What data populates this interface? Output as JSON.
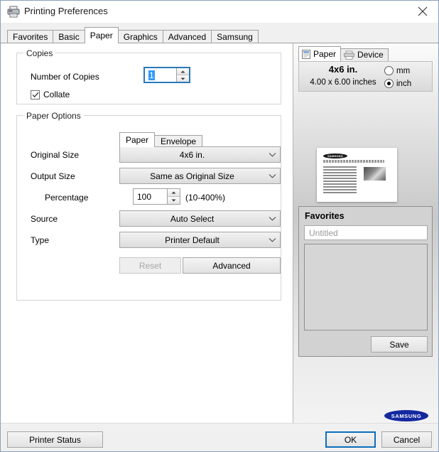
{
  "window": {
    "title": "Printing Preferences",
    "icon": "printer-icon",
    "close_label": "✕"
  },
  "tabs": [
    {
      "label": "Favorites",
      "active": false
    },
    {
      "label": "Basic",
      "active": false
    },
    {
      "label": "Paper",
      "active": true
    },
    {
      "label": "Graphics",
      "active": false
    },
    {
      "label": "Advanced",
      "active": false
    },
    {
      "label": "Samsung",
      "active": false
    }
  ],
  "copies": {
    "legend": "Copies",
    "number_label": "Number of Copies",
    "number_value": "1",
    "collate_label": "Collate",
    "collate_checked": true
  },
  "paper_options": {
    "legend": "Paper Options",
    "subtabs": [
      {
        "label": "Paper",
        "active": true
      },
      {
        "label": "Envelope",
        "active": false
      }
    ],
    "original_size_label": "Original Size",
    "original_size_value": "4x6 in.",
    "output_size_label": "Output Size",
    "output_size_value": "Same as Original Size",
    "percentage_label": "Percentage",
    "percentage_value": "100",
    "percentage_range": "(10-400%)",
    "source_label": "Source",
    "source_value": "Auto Select",
    "type_label": "Type",
    "type_value": "Printer Default",
    "reset_label": "Reset",
    "reset_disabled": true,
    "advanced_label": "Advanced"
  },
  "preview": {
    "tabs": [
      {
        "label": "Paper",
        "icon": "document-icon",
        "active": true
      },
      {
        "label": "Device",
        "icon": "printer-icon",
        "active": false
      }
    ],
    "size_title": "4x6 in.",
    "size_subtitle": "4.00 x 6.00 inches",
    "units": [
      {
        "label": "mm",
        "selected": false
      },
      {
        "label": "inch",
        "selected": true
      }
    ],
    "page_logo_text": "SAMSUNG"
  },
  "favorites": {
    "title": "Favorites",
    "input_placeholder": "Untitled",
    "save_label": "Save"
  },
  "brand": {
    "logo_text": "SAMSUNG"
  },
  "footer": {
    "printer_status_label": "Printer Status",
    "ok_label": "OK",
    "cancel_label": "Cancel"
  },
  "colors": {
    "accent": "#0a6ebd",
    "selection": "#3399ff",
    "samsung_blue": "#1428a0"
  }
}
